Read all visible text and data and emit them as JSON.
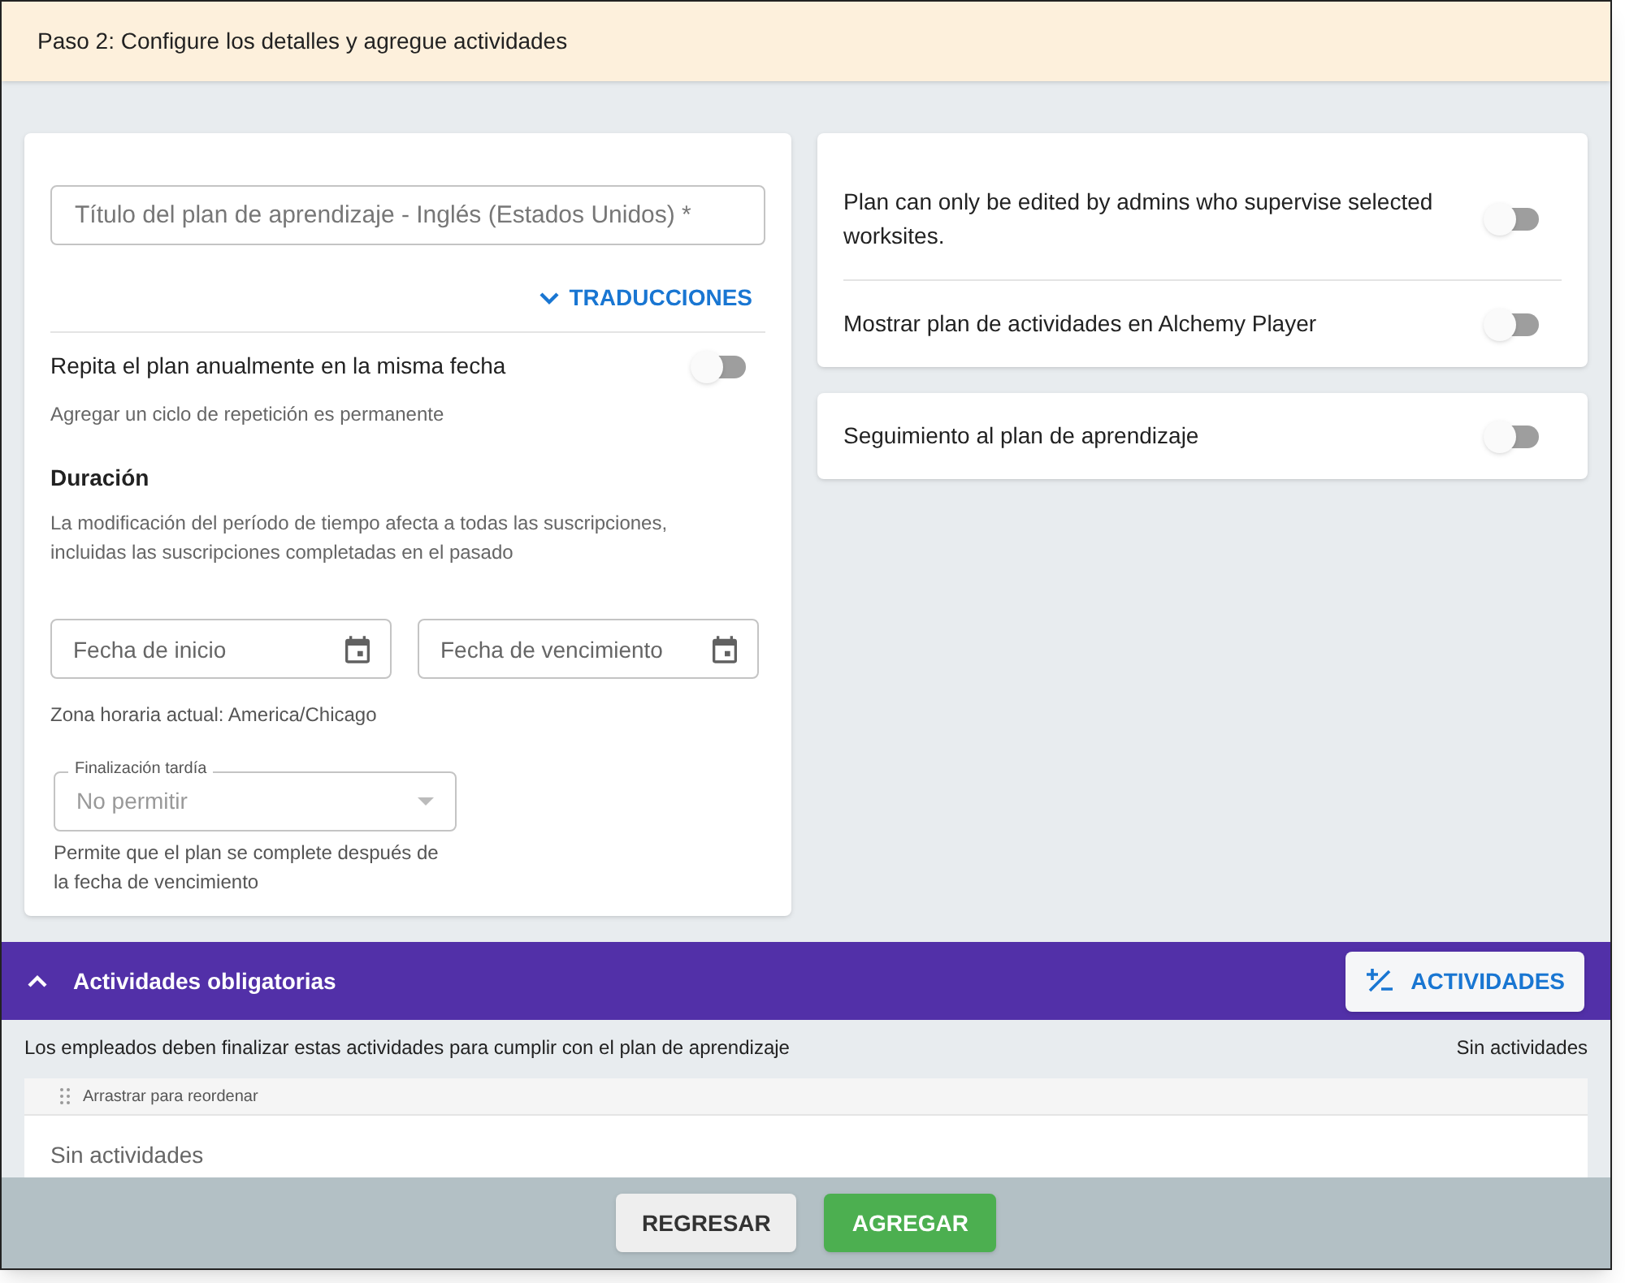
{
  "header": {
    "title": "Paso 2: Configure los detalles y agregue actividades"
  },
  "details": {
    "title_field": {
      "placeholder": "Título del plan de aprendizaje - Inglés (Estados Unidos) *"
    },
    "translations": {
      "label": "TRADUCCIONES",
      "expanded": false
    },
    "repeat": {
      "label": "Repita el plan anualmente en la misma fecha",
      "on": false,
      "hint": "Agregar un ciclo de repetición es permanente"
    },
    "duration": {
      "heading": "Duración",
      "note": "La modificación del período de tiempo afecta a todas las suscripciones, incluidas las suscripciones completadas en el pasado",
      "start": {
        "placeholder": "Fecha de inicio"
      },
      "end": {
        "placeholder": "Fecha de vencimiento"
      },
      "timezone": "Zona horaria actual: America/Chicago"
    },
    "late": {
      "label": "Finalización tardía",
      "value": "No permitir",
      "disabled": true,
      "hint": "Permite que el plan se complete después de la fecha de vencimiento"
    }
  },
  "settings_cards": [
    {
      "rows": [
        {
          "label": "Plan can only be edited by admins who supervise selected worksites.",
          "on": false
        },
        {
          "label": "Mostrar plan de actividades en Alchemy Player",
          "on": false
        }
      ]
    },
    {
      "rows": [
        {
          "label": "Seguimiento al plan de aprendizaje",
          "on": false
        }
      ]
    }
  ],
  "activities": {
    "title": "Actividades obligatorias",
    "expanded": true,
    "add_button": "ACTIVIDADES",
    "description": "Los empleados deben finalizar estas actividades para cumplir con el plan de aprendizaje",
    "count": "Sin actividades",
    "drag_hint": "Arrastrar para reordenar",
    "empty": "Sin actividades"
  },
  "footer": {
    "back": "REGRESAR",
    "add": "AGREGAR"
  }
}
